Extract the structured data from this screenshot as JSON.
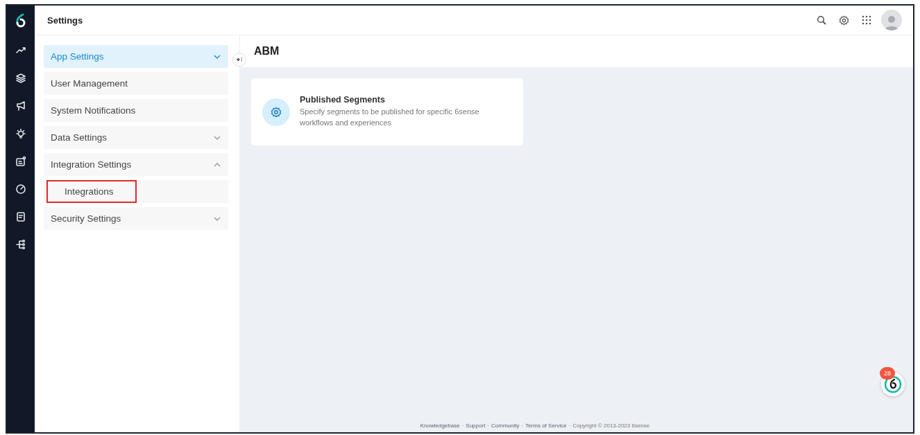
{
  "header": {
    "title": "Settings"
  },
  "rail": {
    "items": [
      {
        "kind": "trend",
        "selected": false
      },
      {
        "kind": "layers",
        "selected": false
      },
      {
        "kind": "megaphone",
        "selected": false
      },
      {
        "kind": "bulb",
        "selected": false
      },
      {
        "kind": "badge",
        "selected": false
      },
      {
        "kind": "gauge",
        "selected": false
      },
      {
        "kind": "report",
        "selected": false
      },
      {
        "kind": "tree",
        "selected": false
      }
    ]
  },
  "menu": [
    {
      "label": "App Settings",
      "kind": "group",
      "selected": true,
      "expanded": false
    },
    {
      "label": "User Management",
      "kind": "link",
      "selected": false
    },
    {
      "label": "System Notifications",
      "kind": "link",
      "selected": false
    },
    {
      "label": "Data Settings",
      "kind": "group",
      "selected": false,
      "expanded": false
    },
    {
      "label": "Integration Settings",
      "kind": "group",
      "selected": false,
      "expanded": true,
      "children": [
        {
          "label": "Integrations",
          "selected": false,
          "outlined": true
        }
      ]
    },
    {
      "label": "Security Settings",
      "kind": "group",
      "selected": false,
      "expanded": false
    }
  ],
  "page": {
    "title": "ABM"
  },
  "cards": [
    {
      "title": "Published Segments",
      "description": "Specify segments to be published for specific 6sense workflows and experiences"
    }
  ],
  "footer": {
    "separator": "·",
    "items": [
      {
        "label": "Knowledgebase",
        "kind": "link"
      },
      {
        "label": "Support",
        "kind": "link"
      },
      {
        "label": "Community",
        "kind": "link"
      },
      {
        "label": "Terms of Service",
        "kind": "link"
      },
      {
        "label": "Copyright © 2013-2023 6sense",
        "kind": "text"
      }
    ]
  },
  "chat": {
    "badge": "28"
  }
}
